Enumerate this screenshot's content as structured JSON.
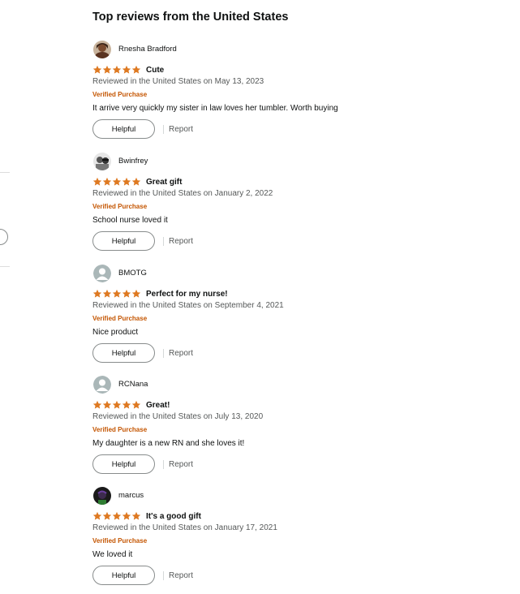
{
  "section": {
    "title": "Top reviews from the United States"
  },
  "colors": {
    "star": "#de7921",
    "verified": "#c45500",
    "meta": "#565959",
    "text": "#0f1111"
  },
  "reviews": [
    {
      "avatar": "photo-avatar-woman",
      "author": "Rnesha Bradford",
      "rating": 5,
      "title": "Cute",
      "date": "Reviewed in the United States on May 13, 2023",
      "verified": "Verified Purchase",
      "body": "It arrive very quickly my sister in law loves her tumbler. Worth buying",
      "helpful": "Helpful",
      "report": "Report"
    },
    {
      "avatar": "photo-avatar-bw",
      "author": "Bwinfrey",
      "rating": 5,
      "title": "Great gift",
      "date": "Reviewed in the United States on January 2, 2022",
      "verified": "Verified Purchase",
      "body": "School nurse loved it",
      "helpful": "Helpful",
      "report": "Report"
    },
    {
      "avatar": "default-avatar",
      "author": "BMOTG",
      "rating": 5,
      "title": "Perfect for my nurse!",
      "date": "Reviewed in the United States on September 4, 2021",
      "verified": "Verified Purchase",
      "body": "Nice product",
      "helpful": "Helpful",
      "report": "Report"
    },
    {
      "avatar": "default-avatar",
      "author": "RCNana",
      "rating": 5,
      "title": "Great!",
      "date": "Reviewed in the United States on July 13, 2020",
      "verified": "Verified Purchase",
      "body": "My daughter is a new RN and she loves it!",
      "helpful": "Helpful",
      "report": "Report"
    },
    {
      "avatar": "photo-avatar-dark",
      "author": "marcus",
      "rating": 5,
      "title": "It's a good gift",
      "date": "Reviewed in the United States on January 17, 2021",
      "verified": "Verified Purchase",
      "body": "We loved it",
      "helpful": "Helpful",
      "report": "Report"
    }
  ]
}
